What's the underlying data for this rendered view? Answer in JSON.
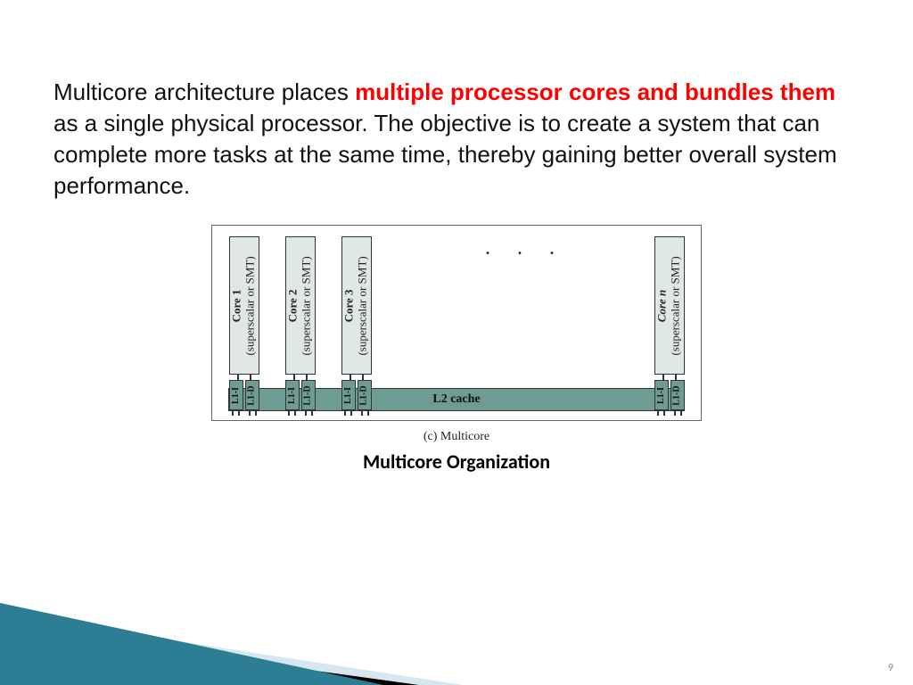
{
  "para": {
    "p1": "Multicore architecture places ",
    "hl": "multiple processor cores and bundles them",
    "p2": " as a single physical processor. The objective is to create a system that can complete more tasks at the same time, thereby gaining better overall system performance."
  },
  "cores": {
    "core1_name": "Core 1",
    "core2_name": "Core 2",
    "core3_name": "Core 3",
    "coren_name": "Core n",
    "core_type": "(superscalar or SMT)",
    "l1i": "L1-I",
    "l1d": "L1-D"
  },
  "dots": ". . .",
  "l2": "L2 cache",
  "figlabel": "(c) Multicore",
  "caption": "Multicore Organization",
  "pagenum": "9"
}
